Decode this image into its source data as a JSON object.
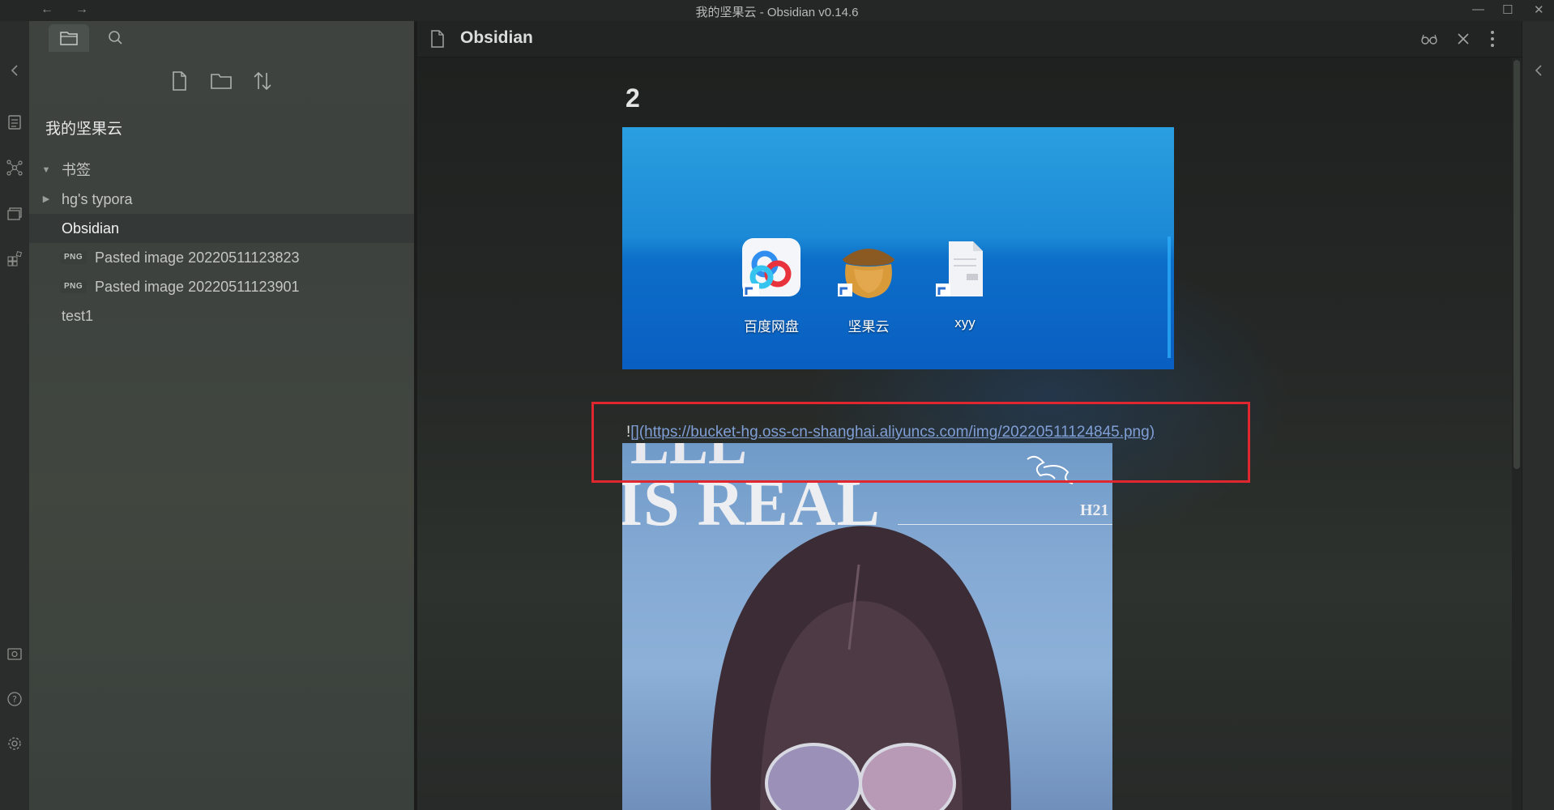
{
  "window": {
    "title": "我的坚果云 - Obsidian v0.14.6"
  },
  "sidebar": {
    "vault_name": "我的坚果云",
    "tree": [
      {
        "label": "书签",
        "type": "folder",
        "expanded": true
      },
      {
        "label": "hg's typora",
        "type": "folder",
        "expanded": false
      },
      {
        "label": "Obsidian",
        "type": "file",
        "active": true
      },
      {
        "label": "Pasted image 20220511123823",
        "type": "image",
        "badge": "PNG"
      },
      {
        "label": "Pasted image 20220511123901",
        "type": "image",
        "badge": "PNG"
      },
      {
        "label": "test1",
        "type": "file"
      }
    ]
  },
  "editor": {
    "title": "Obsidian",
    "heading": "2",
    "desktop_icons": [
      {
        "label": "百度网盘",
        "icon": "baidu-netdisk-icon"
      },
      {
        "label": "坚果云",
        "icon": "nutstore-icon"
      },
      {
        "label": "xyy",
        "icon": "markdown-file-icon"
      }
    ],
    "link": {
      "prefix": "!",
      "brackets": "[]",
      "url": "(https://bucket-hg.oss-cn-shanghai.aliyuncs.com/img/20220511124845.png)"
    },
    "photo_text": {
      "line1": "LLL",
      "line2": "IS REAL",
      "corner": "H21"
    }
  },
  "colors": {
    "accent_link": "#7f9fd6",
    "highlight_box": "#e0262e",
    "sidebar_bg": "#3e433f",
    "editor_bg": "#242625"
  }
}
